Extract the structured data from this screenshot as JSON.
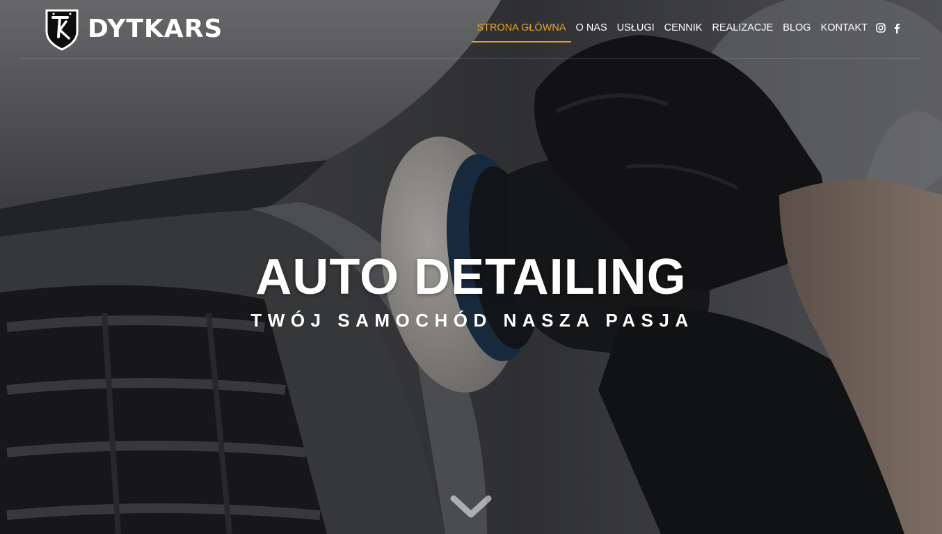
{
  "brand": {
    "name": "DYTKARS",
    "logo_monogram": "TK"
  },
  "nav": {
    "items": [
      {
        "label": "STRONA GŁÓWNA",
        "active": true
      },
      {
        "label": "O NAS"
      },
      {
        "label": "USŁUGI"
      },
      {
        "label": "CENNIK"
      },
      {
        "label": "REALIZACJE"
      },
      {
        "label": "BLOG"
      },
      {
        "label": "KONTAKT"
      }
    ],
    "social": [
      "instagram-icon",
      "facebook-icon"
    ]
  },
  "hero": {
    "title": "AUTO DETAILING",
    "subtitle": "TWÓJ SAMOCHÓD NASZA PASJA",
    "scroll_icon": "chevron-down-icon"
  },
  "colors": {
    "accent": "#e5a324",
    "text": "#ffffff",
    "glove": "#151618",
    "car_body": "#5f6063"
  }
}
